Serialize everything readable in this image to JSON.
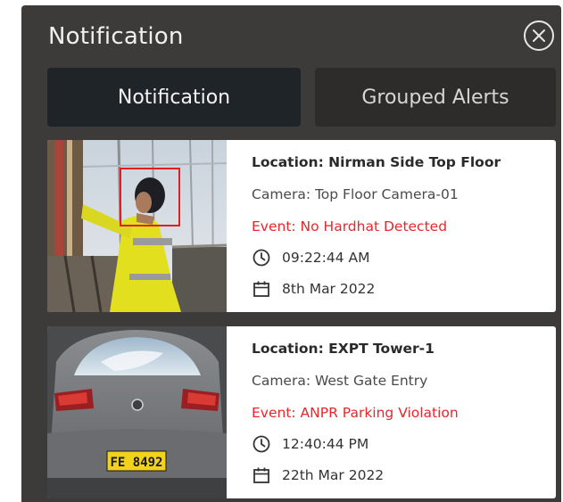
{
  "panel": {
    "title": "Notification",
    "close_icon": "close-circle-icon"
  },
  "tabs": [
    {
      "label": "Notification",
      "active": true
    },
    {
      "label": "Grouped Alerts",
      "active": false
    }
  ],
  "notifications": [
    {
      "location": "Location: Nirman Side Top Floor",
      "camera": "Camera: Top Floor Camera-01",
      "event": "Event: No Hardhat Detected",
      "time": "09:22:44 AM",
      "date": "8th Mar 2022",
      "thumbnail": "worker-without-hardhat-image"
    },
    {
      "location": "Location: EXPT Tower-1",
      "camera": "Camera: West Gate Entry",
      "event": "Event: ANPR Parking Violation",
      "time": "12:40:44 PM",
      "date": "22th Mar 2022",
      "thumbnail": "car-rear-license-plate-image",
      "plate": "FE 8492"
    }
  ],
  "colors": {
    "panel_bg": "#3d3b39",
    "tab_active_bg": "#1f2428",
    "tab_inactive_bg": "#2e2c2a",
    "event_red": "#e8272b"
  }
}
